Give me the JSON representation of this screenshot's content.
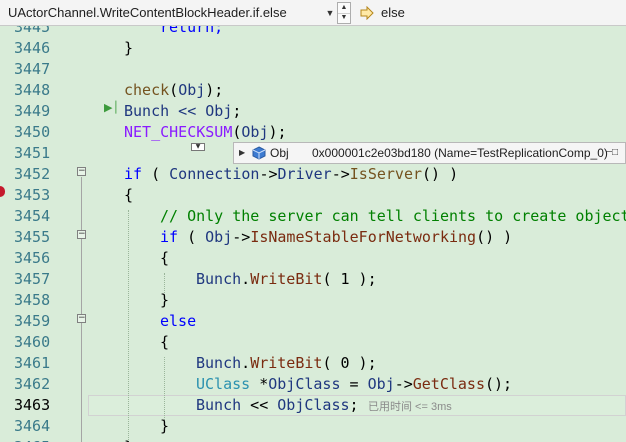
{
  "navbar": {
    "scope": "UActorChannel.WriteContentBlockHeader.if.else",
    "member": "else"
  },
  "icons": {
    "scope_dropdown": "chevron-down-icon",
    "spin": "spin-buttons-icon",
    "member": "member-arrow-icon",
    "tooltip_expand": "expand-triangle-icon",
    "tooltip_object": "object-icon",
    "tooltip_pin": "pin-icon",
    "current_statement": "current-statement-arrow-icon",
    "breakpoint": "breakpoint-icon"
  },
  "colors": {
    "background": "#d9ecd9",
    "keyword": "#0000ff",
    "type": "#2b91af",
    "comment": "#008000",
    "function": "#74531f",
    "macro": "#8a1bff",
    "variable": "#1f377f",
    "line_number": "#3a7a8a",
    "breakpoint": "#c5192d"
  },
  "editor": {
    "lines": [
      {
        "n": "3445"
      },
      {
        "n": "3446",
        "t0": "}"
      },
      {
        "n": "3447"
      },
      {
        "n": "3448",
        "f0": "check",
        "p0": "(",
        "v0": "Obj",
        "t0": ");"
      },
      {
        "n": "3449",
        "t0": "Bunch << ",
        "v0": "Obj",
        "t1": ";"
      },
      {
        "n": "3450",
        "m0": "NET_CHECKSUM",
        "t0": "(",
        "v0": "Obj",
        "t1": ");"
      },
      {
        "n": "3451"
      },
      {
        "n": "3452",
        "k0": "if",
        "t0": " ( ",
        "v0": "Connection",
        "t1": "->",
        "v1": "Driver",
        "t2": "->",
        "f0": "IsServer",
        "t3": "() )"
      },
      {
        "n": "3453",
        "t0": "{"
      },
      {
        "n": "3454",
        "c0": "// Only the server can tell clients to create objects directly"
      },
      {
        "n": "3455",
        "k0": "if",
        "t0": " ( ",
        "v0": "Obj",
        "t1": "->",
        "f0": "IsNameStableForNetworking",
        "t2": "() )"
      },
      {
        "n": "3456",
        "t0": "{"
      },
      {
        "n": "3457",
        "v0": "Bunch",
        "t0": ".",
        "f0": "WriteBit",
        "t1": "( 1 );"
      },
      {
        "n": "3458",
        "t0": "}"
      },
      {
        "n": "3459",
        "k0": "else"
      },
      {
        "n": "3460",
        "t0": "{"
      },
      {
        "n": "3461",
        "v0": "Bunch",
        "t0": ".",
        "f0": "WriteBit",
        "t1": "( 0 );"
      },
      {
        "n": "3462",
        "y0": "UClass",
        "t0": " *",
        "v0": "ObjClass",
        "t1": " = ",
        "v1": "Obj",
        "t2": "->",
        "f0": "GetClass",
        "t3": "();"
      },
      {
        "n": "3463",
        "v0": "Bunch",
        "t0": " << ",
        "v1": "ObjClass",
        "t1": ";"
      },
      {
        "n": "3464",
        "t0": "}"
      },
      {
        "n": "3465",
        "t0": "}"
      }
    ],
    "first_line_code": "return;",
    "elapsed_hint": "已用时间 <= 3ms"
  },
  "datatip": {
    "name": "Obj",
    "value": "0x000001c2e03bd180 (Name=TestReplicationComp_0)"
  }
}
